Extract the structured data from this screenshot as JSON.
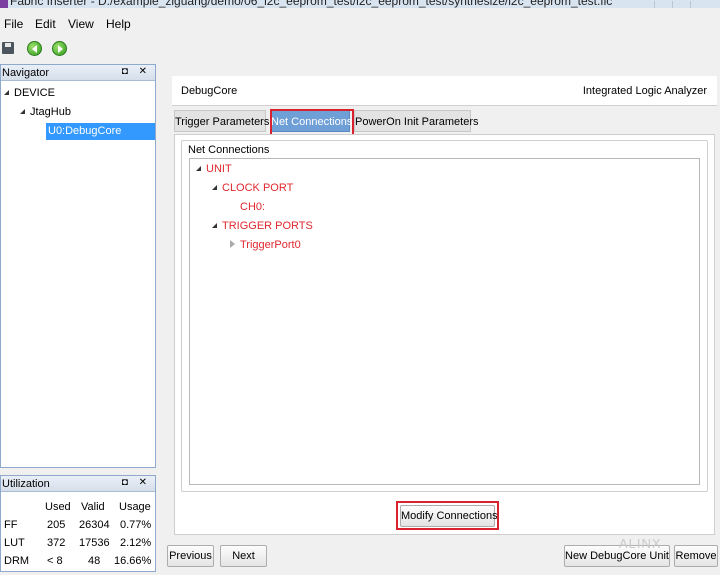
{
  "window": {
    "title": "Fabric Inserter - D:/example_ziguang/demo/06_i2c_eeprom_test/i2c_eeprom_test/synthesize/i2c_eeprom_test.fic"
  },
  "menu": [
    "File",
    "Edit",
    "View",
    "Help"
  ],
  "navigator": {
    "title": "Navigator",
    "buttons": "◘ ✕",
    "tree": {
      "device": "DEVICE",
      "hub": "JtagHub",
      "core": "U0:DebugCore"
    }
  },
  "utilization": {
    "title": "Utilization",
    "buttons": "◘ ✕",
    "headers": [
      "Used",
      "Valid",
      "Usage"
    ],
    "rows": [
      {
        "name": "FF",
        "used": "205",
        "valid": "26304",
        "usage": "0.77%"
      },
      {
        "name": "LUT",
        "used": "372",
        "valid": "17536",
        "usage": "2.12%"
      },
      {
        "name": "DRM",
        "used": "< 8",
        "valid": "48",
        "usage": "16.66%"
      }
    ]
  },
  "main": {
    "header_left": "DebugCore",
    "header_right": "Integrated Logic Analyzer",
    "tabs": [
      "Trigger Parameters",
      "Net Connections",
      "PowerOn Init Parameters"
    ],
    "active_tab": "Net Connections",
    "group_label": "Net Connections",
    "tree": {
      "unit": "UNIT",
      "clock": "CLOCK PORT",
      "ch0": "CH0:",
      "trigger": "TRIGGER PORTS",
      "port0": "TriggerPort0"
    },
    "modify_button": "Modify Connections"
  },
  "footer": {
    "previous": "Previous",
    "next": "Next",
    "new_unit": "New DebugCore Unit",
    "remove": "Remove"
  },
  "watermark": "ALINX",
  "colors": {
    "highlight": "#d8222c",
    "tree_text": "#e0282e",
    "selection": "#3399ff",
    "active_tab": "#6e9fd6"
  }
}
